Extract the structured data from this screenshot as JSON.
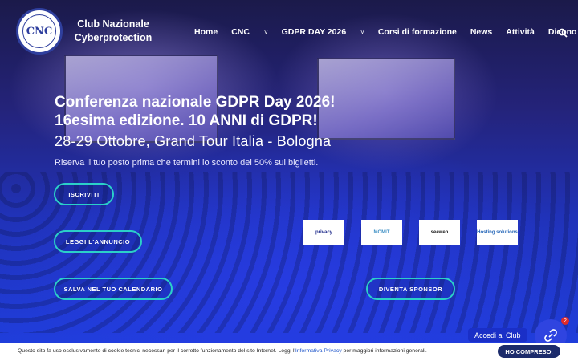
{
  "header": {
    "logo_text": "CNC",
    "brand_line1": "Club Nazionale",
    "brand_line2": "Cyberprotection"
  },
  "nav": {
    "items": [
      {
        "label": "Home"
      },
      {
        "label": "CNC"
      },
      {
        "label": "GDPR DAY 2026"
      },
      {
        "label": "Corsi di formazione"
      },
      {
        "label": "News"
      },
      {
        "label": "Attività"
      },
      {
        "label": "Dicono di noi"
      }
    ],
    "caret": "˅"
  },
  "hero": {
    "headline_line1": "Conferenza nazionale GDPR Day 2026!",
    "headline_line2": "16esima edizione. 10 ANNI di GDPR!",
    "subhead": "28-29 Ottobre, Grand Tour Italia - Bologna",
    "tagline": "Riserva il tuo posto prima che termini lo sconto del 50% sui biglietti."
  },
  "buttons": {
    "iscriviti": "ISCRIVITI",
    "annuncio": "LEGGI L'ANNUNCIO",
    "calendario": "SALVA NEL TUO CALENDARIO",
    "sponsor": "DIVENTA SPONSOR"
  },
  "sponsors": [
    "privacy",
    "MOMIT",
    "seeweb",
    "Hosting solutions"
  ],
  "accedi": {
    "label": "Accedi al Club",
    "badge": "2"
  },
  "cookie": {
    "text_before": "Questo sito fa uso esclusivamente di cookie tecnici necessari per il corretto funzionamento del sito Internet. Leggi l'",
    "link": "Informativa Privacy",
    "text_after": " per maggiori informazioni generali.",
    "button": "HO COMPRESO."
  },
  "colors": {
    "accent_teal": "#2bd0c8",
    "hero_blue": "#1f3fe0",
    "cookie_button": "#1c2b6b"
  }
}
